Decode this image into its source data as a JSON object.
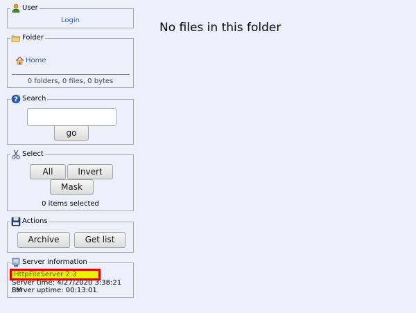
{
  "main": {
    "message": "No files in this folder"
  },
  "user_panel": {
    "title": "User",
    "login_label": "Login",
    "icon": "user-icon"
  },
  "folder_panel": {
    "title": "Folder",
    "home_label": "Home",
    "summary": "0 folders, 0 files, 0 bytes",
    "icon": "folder-icon"
  },
  "search_panel": {
    "title": "Search",
    "input_value": "",
    "go_label": "go",
    "icon": "help-icon"
  },
  "select_panel": {
    "title": "Select",
    "all_label": "All",
    "invert_label": "Invert",
    "mask_label": "Mask",
    "status": "0 items selected",
    "icon": "scissors-icon"
  },
  "actions_panel": {
    "title": "Actions",
    "archive_label": "Archive",
    "getlist_label": "Get list",
    "icon": "floppy-disk-icon"
  },
  "server_panel": {
    "title": "Server information",
    "server_name": "HttpFileServer 2.3",
    "server_time": "Server time: 4/27/2020 3:38:21 PM",
    "server_uptime": "Server uptime: 00:13:01",
    "icon": "server-icon"
  },
  "colors": {
    "background": "#edf0fb",
    "link": "#2a5db0",
    "highlight_border": "#e00000",
    "highlight_fill": "#e8f300"
  }
}
